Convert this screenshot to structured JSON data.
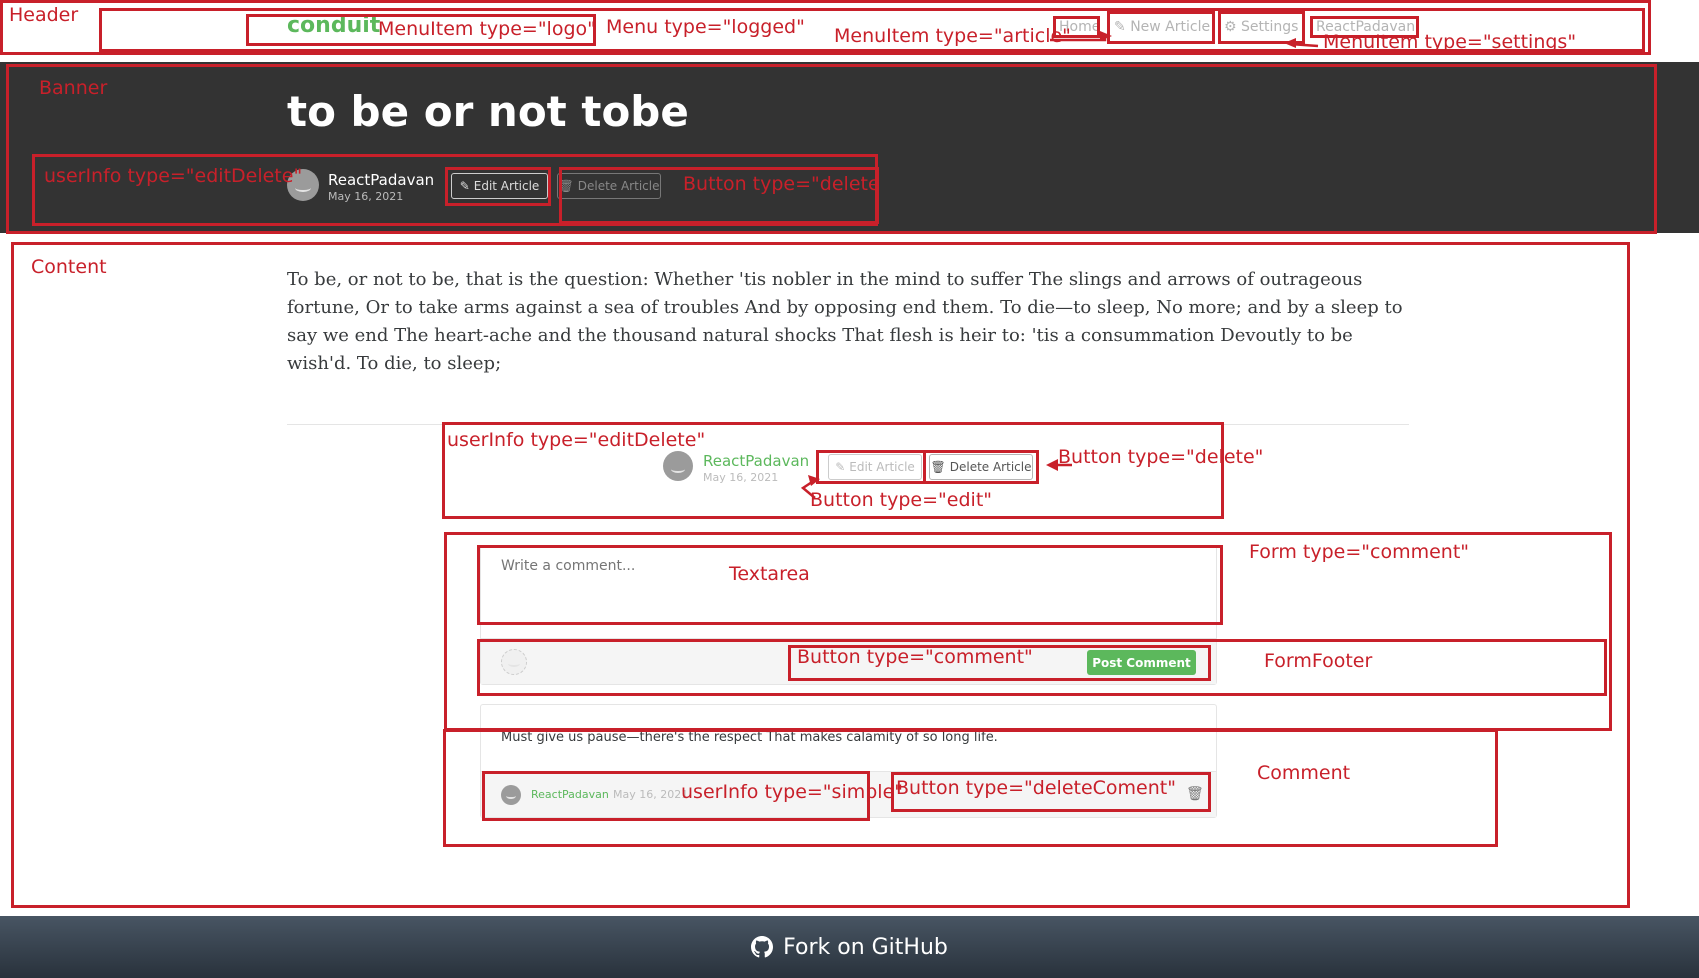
{
  "header": {
    "brand": "conduit",
    "nav": {
      "home": "Home",
      "new_article": "New Article",
      "settings": "Settings",
      "user": "ReactPadavan"
    }
  },
  "banner": {
    "title": "to be or not tobe",
    "author": "ReactPadavan",
    "date": "May 16, 2021",
    "edit_label": "Edit Article",
    "delete_label": "Delete Article"
  },
  "article": {
    "body": "To be, or not to be, that is the question: Whether 'tis nobler in the mind to suffer The slings and arrows of outrageous fortune, Or to take arms against a sea of troubles And by opposing end them. To die—to sleep, No more; and by a sleep to say we end The heart-ache and the thousand natural shocks That flesh is heir to: 'tis a consummation Devoutly to be wish'd. To die, to sleep;"
  },
  "meta": {
    "author": "ReactPadavan",
    "date": "May 16, 2021",
    "edit_label": "Edit Article",
    "delete_label": "Delete Article"
  },
  "comment_form": {
    "placeholder": "Write a comment...",
    "submit_label": "Post Comment"
  },
  "comment": {
    "text": "Must give us pause—there's the respect That makes calamity of so long life.",
    "author": "ReactPadavan",
    "date": "May 16, 2021"
  },
  "footer": {
    "label": "Fork on GitHub"
  },
  "annotations": {
    "header": "Header",
    "logo": "MenuItem type=\"logo\"",
    "menu": "Menu type=\"logged\"",
    "article": "MenuItem type=\"article\"",
    "settings": "MenuItem type=\"settings\"",
    "banner": "Banner",
    "userinfo_banner": "userInfo type=\"editDelete\"",
    "button_delete_banner": "Button type=\"delete",
    "content": "Content",
    "userinfo_meta": "userInfo type=\"editDelete\"",
    "button_delete_meta": "Button type=\"delete\"",
    "button_edit": "Button type=\"edit\"",
    "form_comment": "Form type=\"comment\"",
    "textarea": "Textarea",
    "button_comment": "Button type=\"comment\"",
    "form_footer": "FormFooter",
    "comment": "Comment",
    "userinfo_simple": "userInfo type=\"simple\"",
    "button_delete_comment": "Button type=\"deleteComent\""
  },
  "colors": {
    "brand": "#5cb85c",
    "banner_bg": "#333333",
    "danger": "#b85c5c",
    "annotation": "#c8202a"
  }
}
